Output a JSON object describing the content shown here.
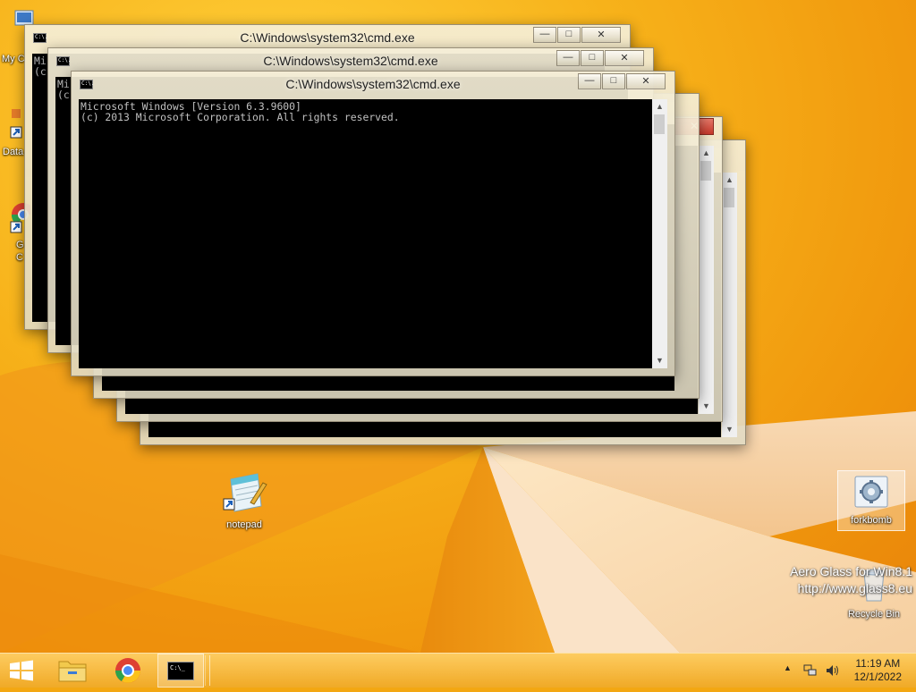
{
  "desktop": {
    "icons": [
      {
        "label": "My C",
        "icon": "computer-icon"
      },
      {
        "label": "Data",
        "icon": "shortcut-icon"
      },
      {
        "label": "G",
        "label2": "C",
        "icon": "chrome-icon"
      },
      {
        "label": "notepad",
        "icon": "notepad-icon"
      },
      {
        "label": "forkbomb",
        "icon": "gear-icon"
      },
      {
        "label": "Recycle Bin",
        "icon": "recycle-bin-icon"
      }
    ]
  },
  "windows": {
    "title": "C:\\Windows\\system32\\cmd.exe",
    "front_console": "Microsoft Windows [Version 6.3.9600]\n(c) 2013 Microsoft Corporation. All rights reserved.",
    "partial_console_1": "Mi\n(c",
    "partial_console_2": "Mi\n(c",
    "icon_text": "C:\\."
  },
  "watermark": {
    "line1": "Aero Glass for Win8.1",
    "line2": "http://www.glass8.eu"
  },
  "taskbar": {
    "start_icon": "windows-logo-icon",
    "pinned": [
      {
        "name": "file-explorer-icon"
      },
      {
        "name": "chrome-icon"
      },
      {
        "name": "cmd-icon",
        "text": "C:\\_"
      }
    ],
    "tray": {
      "time": "11:19 AM",
      "date": "12/1/2022"
    }
  },
  "colors": {
    "accent": "#f3a712",
    "console_bg": "#000000",
    "console_text": "#c0c0c0",
    "close_red": "#c7382a"
  }
}
